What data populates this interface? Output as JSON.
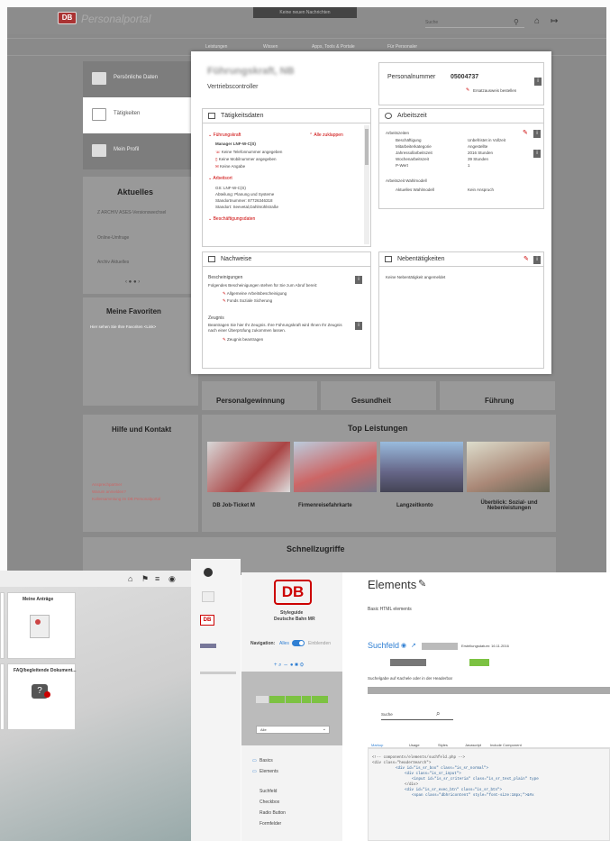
{
  "portal": {
    "logo": "DB",
    "title": "Personalportal",
    "notification": "Keine neuen Nachrichten",
    "search_placeholder": "Suche",
    "nav": [
      "Leistungen",
      "Wissen",
      "Apps, Tools & Portale",
      "Für Personaler"
    ]
  },
  "sidebar": [
    {
      "label": "Persönliche Daten"
    },
    {
      "label": "Tätigkeiten"
    },
    {
      "label": "Mein Profil"
    }
  ],
  "profile": {
    "name": "Führungskraft, NB",
    "role": "Vertriebscontroller",
    "personalnummer_label": "Personalnummer",
    "personalnummer": "05004737",
    "ersatzausweis": "Ersatzausweis bestellen"
  },
  "taetigkeitsdaten": {
    "title": "Tätigkeitsdaten",
    "section1": "Führungskraft",
    "alle_zuklappen": "Alle zuklappen",
    "manager": "Manager LNF-W-C(S)",
    "items": [
      "Keine Telefonnummer angegeben",
      "Keine Mobilnummer angegeben",
      "Keine Angabe"
    ],
    "section2": "Arbeitsort",
    "arbeitsort": [
      "GS: LNF-W-C(S)",
      "Abteilung: Planung und Systeme",
      "Standortnummer: 87726346318",
      "Standort: Seevetal,Dahlmühlstraße"
    ],
    "section3": "Beschäftigungsdaten"
  },
  "arbeitszeit": {
    "title": "Arbeitszeit",
    "sub1": "Arbeitszeiten",
    "rows": [
      [
        "Beschäftigung",
        "Unbefristet in Vollzeit"
      ],
      [
        "Mitarbeiterkategorie",
        "Angestellte"
      ],
      [
        "Jahressollarbeitszeit",
        "2016 Stunden"
      ],
      [
        "Wochenarbeitszeit",
        "39 Stunden"
      ],
      [
        "P-Wert",
        "1"
      ]
    ],
    "sub2": "Arbeitszeit Wahlmodell",
    "wahl": [
      "Aktuelles Wahlmodell",
      "Kein Anspruch"
    ]
  },
  "nachweise": {
    "title": "Nachweise",
    "sub1": "Bescheinigungen",
    "text1": "Folgendes Bescheinigungen stehen für Sie zum Abruf bereit:",
    "link1": "Allgemeine Arbeitsbescheinigung",
    "link2": "Fonds Soziale Sicherung",
    "sub2": "Zeugnis",
    "text2": "Beantragen Sie hier Ihr Zeugnis. Ihre Führungskraft wird Ihnen Ihr Zeugnis nach einer Überprüfung zukommen lassen.",
    "link3": "Zeugnis beantragen"
  },
  "nebentaetigkeiten": {
    "title": "Nebentätigkeiten",
    "text": "Keine Nebentätigkeit angemeldet"
  },
  "background": {
    "aktuelles": "Aktuelles",
    "news": [
      "Z ARCHIV ASES-Versionswechsel",
      "Online-Umfrage",
      "Archiv Aktuelles"
    ],
    "favoriten": "Meine Favoriten",
    "favoriten_text": "Hier sehen Sie Ihre Favoriten <Link>",
    "themen": [
      "Personalgewinnung",
      "Gesundheit",
      "Führung"
    ],
    "hilfe": "Hilfe und Kontakt",
    "hilfe_links": [
      "Ansprechpartner",
      "Warum anmelden?",
      "Kollersammlung im DB Personalportal"
    ],
    "top": "Top Leistungen",
    "leistungen": [
      "DB Job-Ticket M",
      "Firmenreisefahrkarte",
      "Langzeitkonto",
      "Überblick: Sozial- und Nebenleistungen"
    ],
    "schnellzugriffe": "Schnellzugriffe"
  },
  "tiles": [
    "Meine Anträge",
    "FAQ/begleitende Dokument..."
  ],
  "styleguide": {
    "logo": "DB",
    "brand1": "Styleguide",
    "brand2": "Deutsche Bahn MR",
    "navigation": "Navigation:",
    "alles": "Alles",
    "einblenden": "Einblenden",
    "menu": [
      "Basics",
      "Elements",
      "Suchfeld",
      "Checkbox",
      "Radio Button",
      "Formfelder"
    ],
    "page_title": "Elements",
    "subtitle": "Basic HTML elements",
    "suchfeld": "Suchfeld",
    "erstell": "Erstellungsdatum: 16.11.2016",
    "desc": "Suchelgabe auf Kachele oder in der Headerbar",
    "search": "Suche",
    "tabs": [
      "Markup",
      "Usage",
      "Styles",
      "Javascript"
    ],
    "include": "Include Component",
    "code": [
      "<!-- components/elements/suchfeld.php -->",
      "<div class=\"headerSearch\">",
      "<div id=\"is_sr_box\" class=\"is_sr_normal\">",
      "<div class=\"is_sr_input\">",
      "<input id=\"is_sr_criteria\" class=\"is_sr_text_plain\" type",
      "</div>",
      "<div id=\"is_sr_exec_btn\" class=\"is_sr_btn\">",
      "<span class=\"dbhricontent\" style=\"font-size:18px;\">&#x"
    ]
  },
  "colors": {
    "db_red": "#c00000",
    "green": "#7cc242",
    "blue": "#2f7fd3"
  }
}
